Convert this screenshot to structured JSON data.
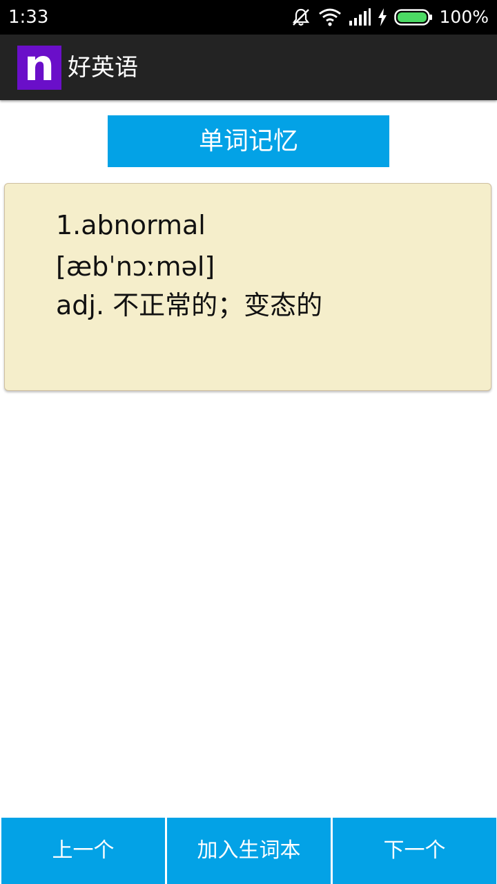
{
  "status_bar": {
    "time": "1:33",
    "battery": "100%",
    "icons": [
      "notifications-off-icon",
      "wifi-icon",
      "signal-icon",
      "charging-icon",
      "battery-icon"
    ],
    "battery_color": "#4cd964"
  },
  "app_bar": {
    "icon_letter": "n",
    "title": "好英语",
    "icon_color": "#6a0fc9"
  },
  "header_button": {
    "label": "单词记忆",
    "color": "#03a2e6"
  },
  "word_card": {
    "title": "1.abnormal",
    "phonetic": "[æbˈnɔːməl]",
    "meaning": "adj.  不正常的；变态的",
    "background": "#f5eecb"
  },
  "bottom_buttons": {
    "prev_label": "上一个",
    "add_label": "加入生词本",
    "next_label": "下一个"
  }
}
